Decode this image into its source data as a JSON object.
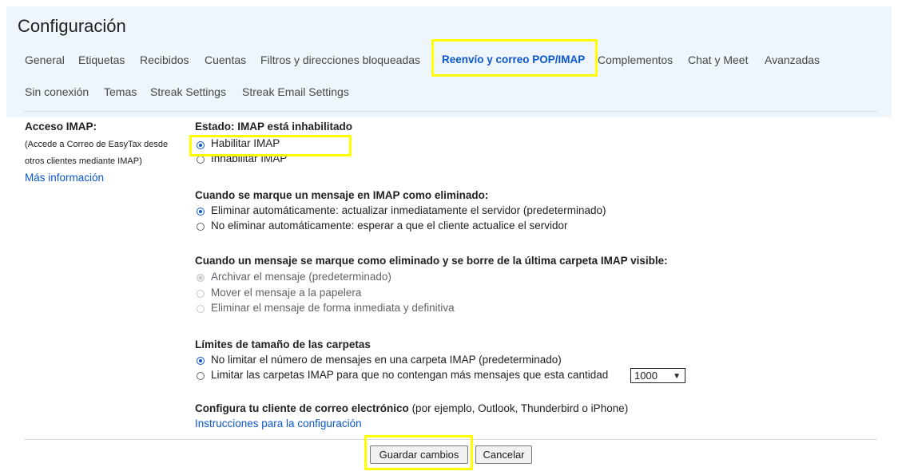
{
  "page_title": "Configuración",
  "tabs_row1": [
    {
      "label": "General"
    },
    {
      "label": "Etiquetas"
    },
    {
      "label": "Recibidos"
    },
    {
      "label": "Cuentas"
    },
    {
      "label": "Filtros y direcciones bloqueadas"
    },
    {
      "label": "Reenvío y correo POP/IMAP",
      "active": true
    },
    {
      "label": "Complementos"
    },
    {
      "label": "Chat y Meet"
    },
    {
      "label": "Avanzadas"
    }
  ],
  "tabs_row2": [
    {
      "label": "Sin conexión"
    },
    {
      "label": "Temas"
    },
    {
      "label": "Streak Settings"
    },
    {
      "label": "Streak Email Settings"
    }
  ],
  "side": {
    "title": "Acceso IMAP:",
    "note_line1": "(Accede a Correo de EasyTax desde",
    "note_line2": "otros clientes mediante IMAP)",
    "link": "Más información"
  },
  "status_section": {
    "title": "Estado: IMAP está inhabilitado",
    "options": [
      {
        "label": "Habilitar IMAP",
        "selected": true
      },
      {
        "label": "Inhabilitar IMAP",
        "selected": false
      }
    ]
  },
  "delete_section": {
    "title": "Cuando se marque un mensaje en IMAP como eliminado:",
    "options": [
      {
        "label": "Eliminar automáticamente: actualizar inmediatamente el servidor (predeterminado)",
        "selected": true
      },
      {
        "label": "No eliminar automáticamente: esperar a que el cliente actualice el servidor",
        "selected": false
      }
    ]
  },
  "expunge_section": {
    "title": "Cuando un mensaje se marque como eliminado y se borre de la última carpeta IMAP visible:",
    "options": [
      {
        "label": "Archivar el mensaje (predeterminado)",
        "selected": true,
        "disabled": true
      },
      {
        "label": "Mover el mensaje a la papelera",
        "selected": false,
        "disabled": true
      },
      {
        "label": "Eliminar el mensaje de forma inmediata y definitiva",
        "selected": false,
        "disabled": true
      }
    ]
  },
  "folder_limits_section": {
    "title": "Límites de tamaño de las carpetas",
    "options": [
      {
        "label": "No limitar el número de mensajes en una carpeta IMAP (predeterminado)",
        "selected": true
      },
      {
        "label": "Limitar las carpetas IMAP para que no contengan más mensajes que esta cantidad",
        "selected": false
      }
    ],
    "limit_select_value": "1000"
  },
  "configure_section": {
    "title_bold": "Configura tu cliente de correo electrónico",
    "title_rest": " (por ejemplo, Outlook, Thunderbird o iPhone)",
    "link": "Instrucciones para la configuración"
  },
  "buttons": {
    "save": "Guardar cambios",
    "cancel": "Cancelar"
  },
  "colors": {
    "header_bg": "#eef6fc",
    "link": "#0b57d0",
    "active_tab": "#0b57d0",
    "highlight": "#ffff00"
  },
  "icons": {
    "select_arrow": "chevron-down-icon"
  }
}
